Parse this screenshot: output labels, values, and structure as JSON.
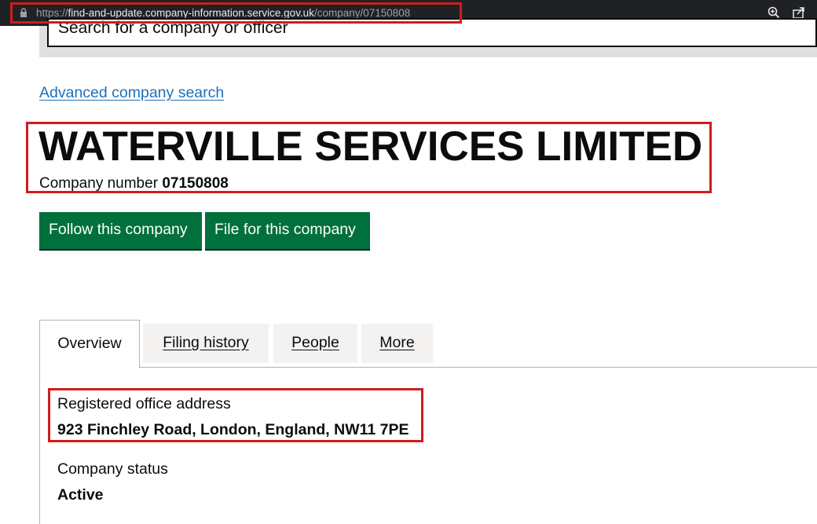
{
  "browser": {
    "url_scheme": "https://",
    "url_host": "find-and-update.company-information.service.gov.uk",
    "url_path": "/company/07150808",
    "icons": [
      "lock-icon",
      "zoom-icon",
      "share-icon"
    ]
  },
  "search": {
    "placeholder": "Search for a company or officer"
  },
  "advanced_search_link": "Advanced company search",
  "company": {
    "name": "WATERVILLE SERVICES LIMITED",
    "number_label": "Company number",
    "number": "07150808"
  },
  "buttons": {
    "follow": "Follow this company",
    "file": "File for this company"
  },
  "tabs": [
    {
      "label": "Overview",
      "active": true
    },
    {
      "label": "Filing history",
      "active": false
    },
    {
      "label": "People",
      "active": false
    },
    {
      "label": "More",
      "active": false
    }
  ],
  "overview": {
    "address_label": "Registered office address",
    "address_value": "923 Finchley Road, London, England, NW11 7PE",
    "status_label": "Company status",
    "status_value": "Active"
  },
  "colors": {
    "button_green": "#00703c",
    "link_blue": "#1d70b8",
    "highlight_red": "#d11c1c"
  }
}
